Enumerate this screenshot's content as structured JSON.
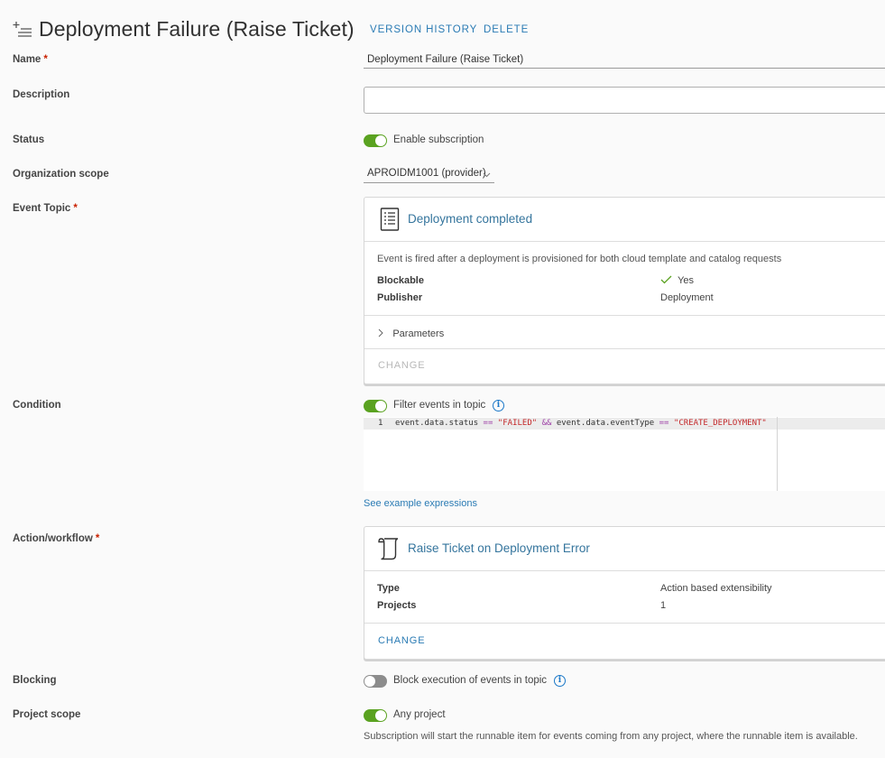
{
  "header": {
    "title": "Deployment Failure (Raise Ticket)",
    "version_history": "VERSION HISTORY",
    "delete": "DELETE"
  },
  "form": {
    "name": {
      "label": "Name",
      "required": "*",
      "value": "Deployment Failure (Raise Ticket)"
    },
    "description": {
      "label": "Description",
      "value": ""
    },
    "status": {
      "label": "Status",
      "toggle_label": "Enable subscription",
      "enabled": true
    },
    "organization_scope": {
      "label": "Organization scope",
      "value": "APROIDM1001 (provider)"
    },
    "event_topic": {
      "label": "Event Topic",
      "required": "*",
      "title": "Deployment completed",
      "description": "Event is fired after a deployment is provisioned for both cloud template and catalog requests",
      "blockable_label": "Blockable",
      "blockable_value": "Yes",
      "publisher_label": "Publisher",
      "publisher_value": "Deployment",
      "parameters": "Parameters",
      "change": "CHANGE"
    },
    "condition": {
      "label": "Condition",
      "toggle_label": "Filter events in topic",
      "enabled": true,
      "line_number": "1",
      "code_parts": {
        "a": "event.data.status ",
        "op1": "==",
        "s1": " \"FAILED\" ",
        "and": "&&",
        "b": " event.data.eventType ",
        "op2": "==",
        "s2": " \"CREATE_DEPLOYMENT\""
      },
      "example_link": "See example expressions"
    },
    "action": {
      "label": "Action/workflow",
      "required": "*",
      "title": "Raise Ticket on Deployment Error",
      "type_label": "Type",
      "type_value": "Action based extensibility",
      "projects_label": "Projects",
      "projects_value": "1",
      "change": "CHANGE"
    },
    "blocking": {
      "label": "Blocking",
      "toggle_label": "Block execution of events in topic",
      "enabled": false
    },
    "project_scope": {
      "label": "Project scope",
      "toggle_label": "Any project",
      "enabled": true,
      "help": "Subscription will start the runnable item for events coming from any project, where the runnable item is available."
    }
  },
  "colors": {
    "accent": "#2a7bb4",
    "toggle_on": "#5aa220",
    "toggle_off": "#8c8c8c",
    "required": "#c92100"
  },
  "icons": {
    "header": "subscription-icon",
    "event_topic": "event-document-icon",
    "action": "script-scroll-icon",
    "info": "info-icon",
    "check": "check-icon",
    "chevron": "chevron-right-icon"
  }
}
